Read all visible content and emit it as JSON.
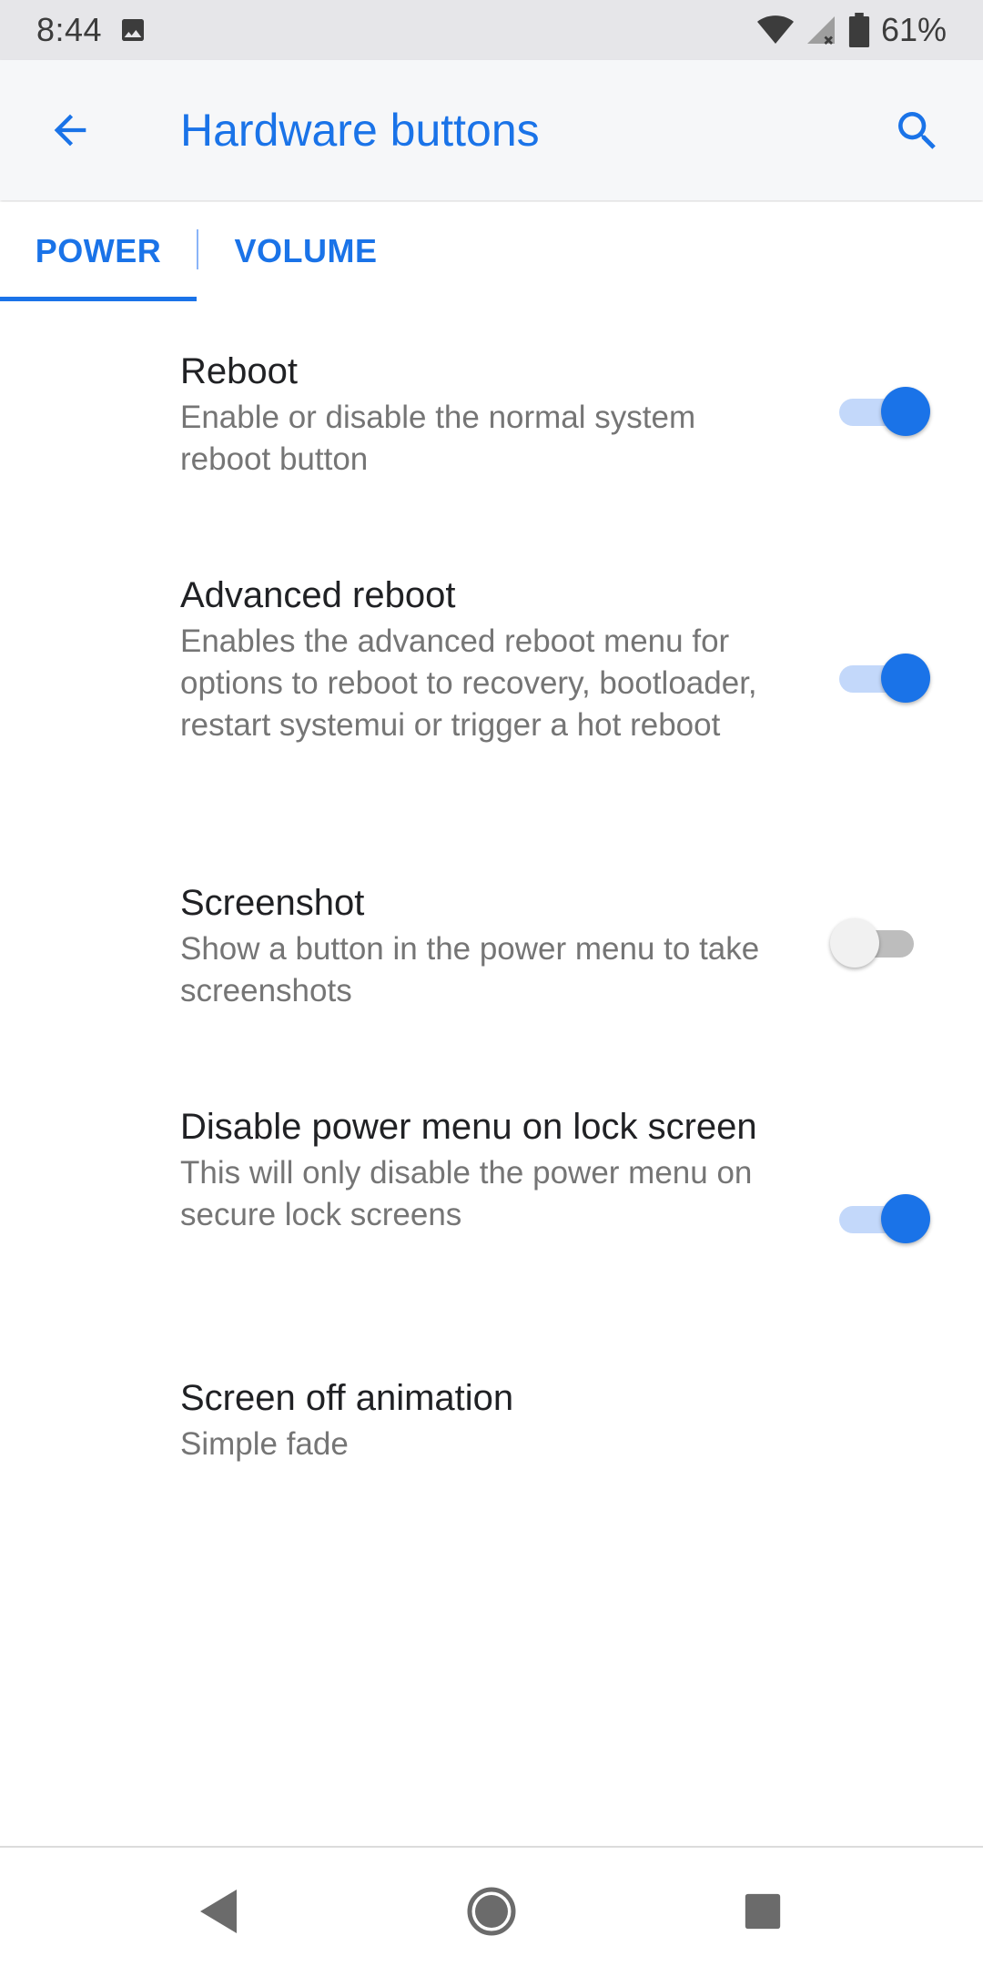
{
  "status_bar": {
    "time": "8:44",
    "battery_percent": "61%",
    "icons": [
      "image-icon",
      "wifi-icon",
      "cell-signal-icon",
      "battery-icon"
    ]
  },
  "app_bar": {
    "title": "Hardware buttons",
    "back_icon": "back-arrow-icon",
    "search_icon": "search-icon"
  },
  "tabs": [
    {
      "label": "POWER",
      "selected": true
    },
    {
      "label": "VOLUME",
      "selected": false
    }
  ],
  "settings": [
    {
      "title": "Reboot",
      "summary": "Enable or disable the normal system reboot button",
      "toggle": true
    },
    {
      "title": "Advanced reboot",
      "summary": "Enables the advanced reboot menu for options to reboot to recovery, bootloader, restart systemui or trigger a hot reboot",
      "toggle": true
    },
    {
      "title": "Screenshot",
      "summary": "Show a button in the power menu to take screenshots",
      "toggle": false
    },
    {
      "title": "Disable power menu on lock screen",
      "summary": "This will only disable the power menu on secure lock screens",
      "toggle": true
    },
    {
      "title": "Screen off animation",
      "summary": "Simple fade"
    }
  ],
  "colors": {
    "accent": "#1a73e8",
    "switch_track_on": "#c3d8fa",
    "text_primary": "#202124",
    "text_secondary": "#757575"
  },
  "nav_bar": {
    "buttons": [
      "nav-back-icon",
      "nav-home-icon",
      "nav-recents-icon"
    ]
  }
}
